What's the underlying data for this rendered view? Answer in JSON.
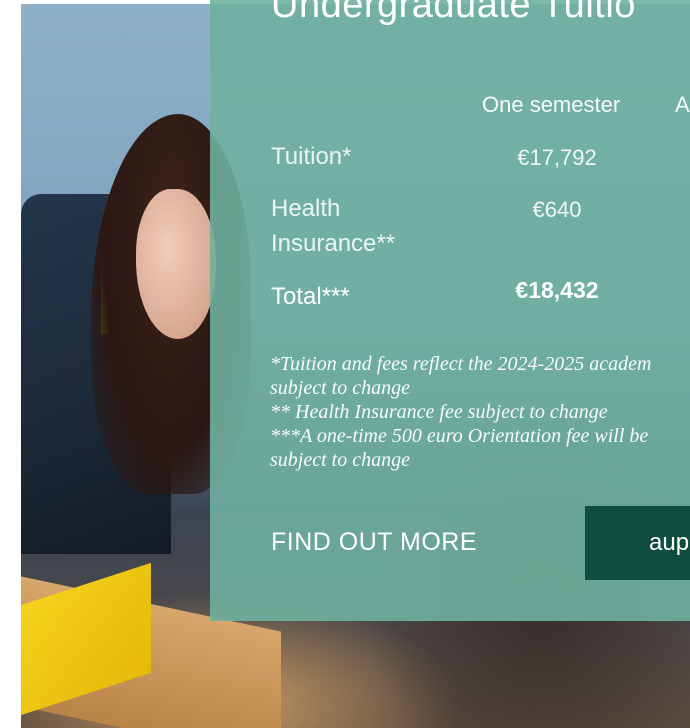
{
  "panel": {
    "title": "Undergraduate Tuitio",
    "columns": [
      "One semester",
      "A"
    ],
    "rows": [
      {
        "label_line1": "Tuition*",
        "label_line2": "",
        "value": "€17,792"
      },
      {
        "label_line1": "Health",
        "label_line2": "Insurance**",
        "value": "€640"
      },
      {
        "label_line1": "Total***",
        "label_line2": "",
        "value": "€18,432"
      }
    ],
    "notes": [
      "*Tuition and fees reflect the 2024-2025 academ",
      "subject to change",
      "** Health Insurance fee subject to change",
      "***A one-time 500 euro Orientation fee will be",
      "subject to change"
    ],
    "find_out_more": "FIND OUT MORE",
    "cta_label": "aup"
  },
  "colors": {
    "panel": "#6fb09e",
    "cta": "#0f4e3c"
  }
}
